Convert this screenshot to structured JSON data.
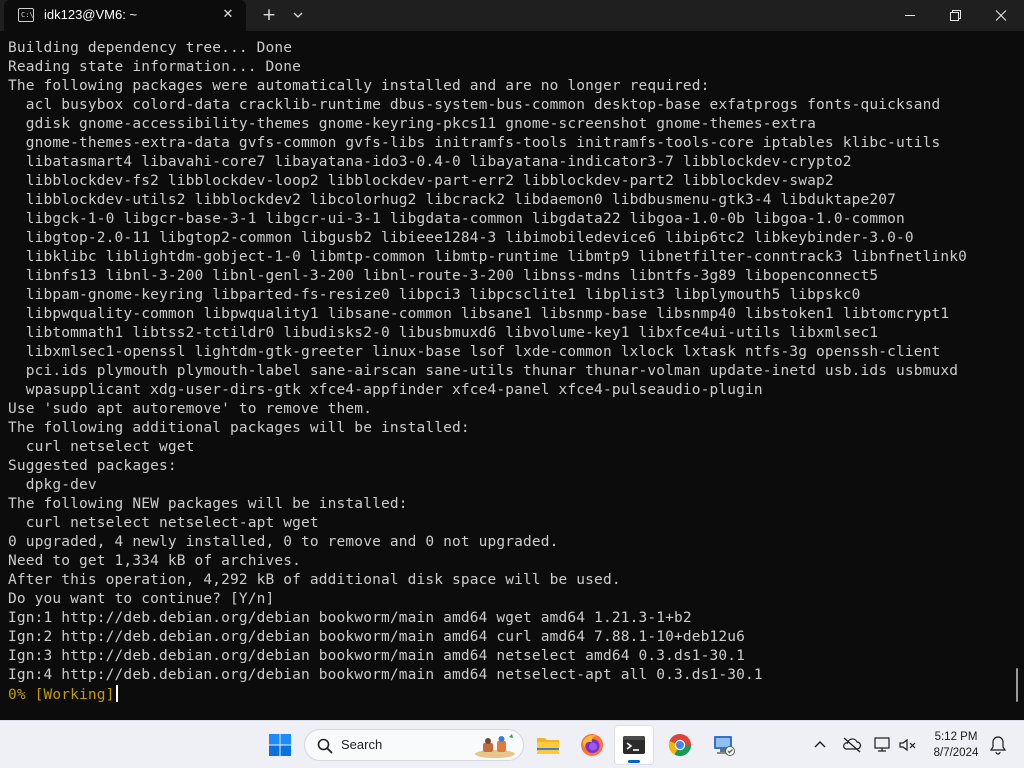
{
  "window": {
    "tab_title": "idk123@VM6: ~",
    "tab_icon_text": "C:\\",
    "close_tab_glyph": "✕",
    "new_tab_glyph": "+"
  },
  "terminal": {
    "lines": [
      "Building dependency tree... Done",
      "Reading state information... Done",
      "The following packages were automatically installed and are no longer required:",
      "  acl busybox colord-data cracklib-runtime dbus-system-bus-common desktop-base exfatprogs fonts-quicksand",
      "  gdisk gnome-accessibility-themes gnome-keyring-pkcs11 gnome-screenshot gnome-themes-extra",
      "  gnome-themes-extra-data gvfs-common gvfs-libs initramfs-tools initramfs-tools-core iptables klibc-utils",
      "  libatasmart4 libavahi-core7 libayatana-ido3-0.4-0 libayatana-indicator3-7 libblockdev-crypto2",
      "  libblockdev-fs2 libblockdev-loop2 libblockdev-part-err2 libblockdev-part2 libblockdev-swap2",
      "  libblockdev-utils2 libblockdev2 libcolorhug2 libcrack2 libdaemon0 libdbusmenu-gtk3-4 libduktape207",
      "  libgck-1-0 libgcr-base-3-1 libgcr-ui-3-1 libgdata-common libgdata22 libgoa-1.0-0b libgoa-1.0-common",
      "  libgtop-2.0-11 libgtop2-common libgusb2 libieee1284-3 libimobiledevice6 libip6tc2 libkeybinder-3.0-0",
      "  libklibc liblightdm-gobject-1-0 libmtp-common libmtp-runtime libmtp9 libnetfilter-conntrack3 libnfnetlink0",
      "  libnfs13 libnl-3-200 libnl-genl-3-200 libnl-route-3-200 libnss-mdns libntfs-3g89 libopenconnect5",
      "  libpam-gnome-keyring libparted-fs-resize0 libpci3 libpcsclite1 libplist3 libplymouth5 libpskc0",
      "  libpwquality-common libpwquality1 libsane-common libsane1 libsnmp-base libsnmp40 libstoken1 libtomcrypt1",
      "  libtommath1 libtss2-tctildr0 libudisks2-0 libusbmuxd6 libvolume-key1 libxfce4ui-utils libxmlsec1",
      "  libxmlsec1-openssl lightdm-gtk-greeter linux-base lsof lxde-common lxlock lxtask ntfs-3g openssh-client",
      "  pci.ids plymouth plymouth-label sane-airscan sane-utils thunar thunar-volman update-inetd usb.ids usbmuxd",
      "  wpasupplicant xdg-user-dirs-gtk xfce4-appfinder xfce4-panel xfce4-pulseaudio-plugin",
      "Use 'sudo apt autoremove' to remove them.",
      "The following additional packages will be installed:",
      "  curl netselect wget",
      "Suggested packages:",
      "  dpkg-dev",
      "The following NEW packages will be installed:",
      "  curl netselect netselect-apt wget",
      "0 upgraded, 4 newly installed, 0 to remove and 0 not upgraded.",
      "Need to get 1,334 kB of archives.",
      "After this operation, 4,292 kB of additional disk space will be used.",
      "Do you want to continue? [Y/n]",
      "Ign:1 http://deb.debian.org/debian bookworm/main amd64 wget amd64 1.21.3-1+b2",
      "Ign:2 http://deb.debian.org/debian bookworm/main amd64 curl amd64 7.88.1-10+deb12u6",
      "Ign:3 http://deb.debian.org/debian bookworm/main amd64 netselect amd64 0.3.ds1-30.1",
      "Ign:4 http://deb.debian.org/debian bookworm/main amd64 netselect-apt all 0.3.ds1-30.1"
    ],
    "status_line": "0% [Working]"
  },
  "taskbar": {
    "search_label": "Search",
    "clock_time": "5:12 PM",
    "clock_date": "8/7/2024",
    "apps": [
      {
        "name": "start-button-icon"
      },
      {
        "name": "file-explorer-icon"
      },
      {
        "name": "firefox-icon"
      },
      {
        "name": "terminal-icon",
        "active": true
      },
      {
        "name": "chrome-icon"
      },
      {
        "name": "remote-desktop-icon"
      }
    ]
  },
  "colors": {
    "terminal_bg": "#0c0c0c",
    "terminal_fg": "#cccccc",
    "status_fg": "#c19c00",
    "titlebar_bg": "#1f1f1f",
    "taskbar_bg": "#eef0f6",
    "accent": "#0067c0"
  }
}
